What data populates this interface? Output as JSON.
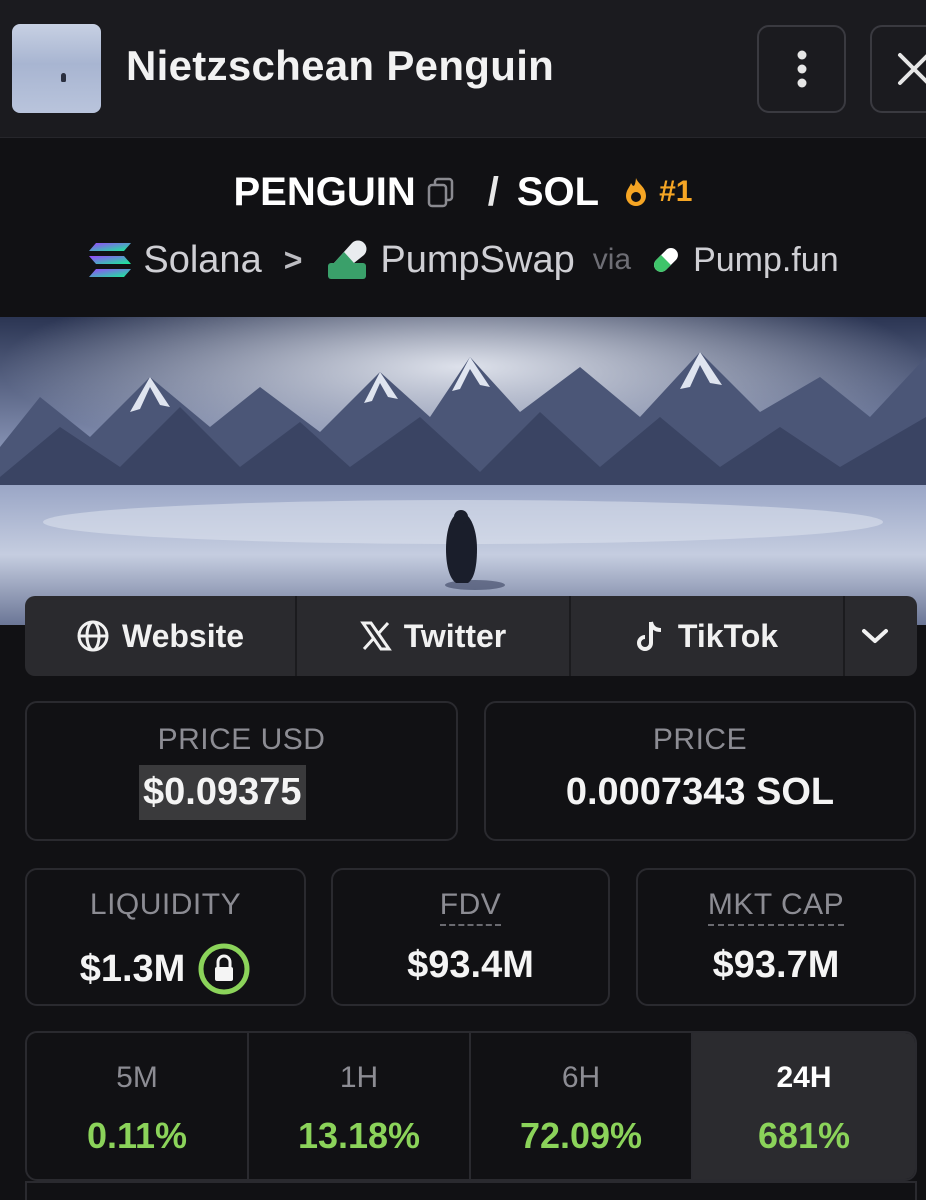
{
  "header": {
    "title": "Nietzschean Penguin"
  },
  "pair": {
    "base": "PENGUIN",
    "separator": "/",
    "quote": "SOL",
    "rank": "#1"
  },
  "chain": {
    "network": "Solana",
    "dex": "PumpSwap",
    "via": "via",
    "launchpad": "Pump.fun"
  },
  "social": {
    "website": "Website",
    "twitter": "Twitter",
    "tiktok": "TikTok"
  },
  "stats": {
    "price_usd_label": "PRICE USD",
    "price_usd": "$0.09375",
    "price_label": "PRICE",
    "price": "0.0007343 SOL",
    "liquidity_label": "LIQUIDITY",
    "liquidity": "$1.3M",
    "fdv_label": "FDV",
    "fdv": "$93.4M",
    "mkt_cap_label": "MKT CAP",
    "mkt_cap": "$93.7M"
  },
  "timeframes": [
    {
      "label": "5M",
      "change": "0.11%"
    },
    {
      "label": "1H",
      "change": "13.18%"
    },
    {
      "label": "6H",
      "change": "72.09%"
    },
    {
      "label": "24H",
      "change": "681%"
    }
  ],
  "colors": {
    "positive": "#8bd35a",
    "rank": "#f5a524",
    "lock": "#8bd35a"
  }
}
